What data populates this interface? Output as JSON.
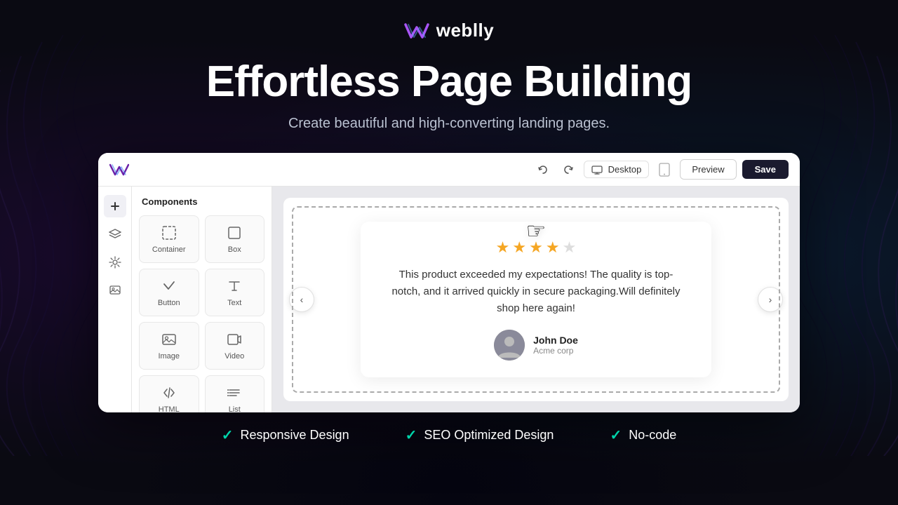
{
  "brand": {
    "name": "weblly",
    "logo_alt": "Weblly logo"
  },
  "hero": {
    "title": "Effortless Page Building",
    "subtitle": "Create beautiful and high-converting landing pages."
  },
  "toolbar": {
    "device_label": "Desktop",
    "preview_label": "Preview",
    "save_label": "Save"
  },
  "components_panel": {
    "title": "Components",
    "items": [
      {
        "label": "Container",
        "icon": "container-icon"
      },
      {
        "label": "Box",
        "icon": "box-icon"
      },
      {
        "label": "Button",
        "icon": "button-icon"
      },
      {
        "label": "Text",
        "icon": "text-icon"
      },
      {
        "label": "Image",
        "icon": "image-icon"
      },
      {
        "label": "Video",
        "icon": "video-icon"
      },
      {
        "label": "HTML",
        "icon": "html-icon"
      },
      {
        "label": "List",
        "icon": "list-icon"
      }
    ]
  },
  "testimonial": {
    "stars": 4,
    "text": "This product exceeded my expectations! The quality is top-notch, and it arrived quickly in secure packaging.Will definitely shop here again!",
    "author_name": "John Doe",
    "author_company": "Acme corp"
  },
  "features": [
    {
      "label": "Responsive Design"
    },
    {
      "label": "SEO Optimized Design"
    },
    {
      "label": "No-code"
    }
  ],
  "colors": {
    "check": "#00d4aa",
    "star": "#f5a623",
    "save_bg": "#1a1a2e"
  }
}
